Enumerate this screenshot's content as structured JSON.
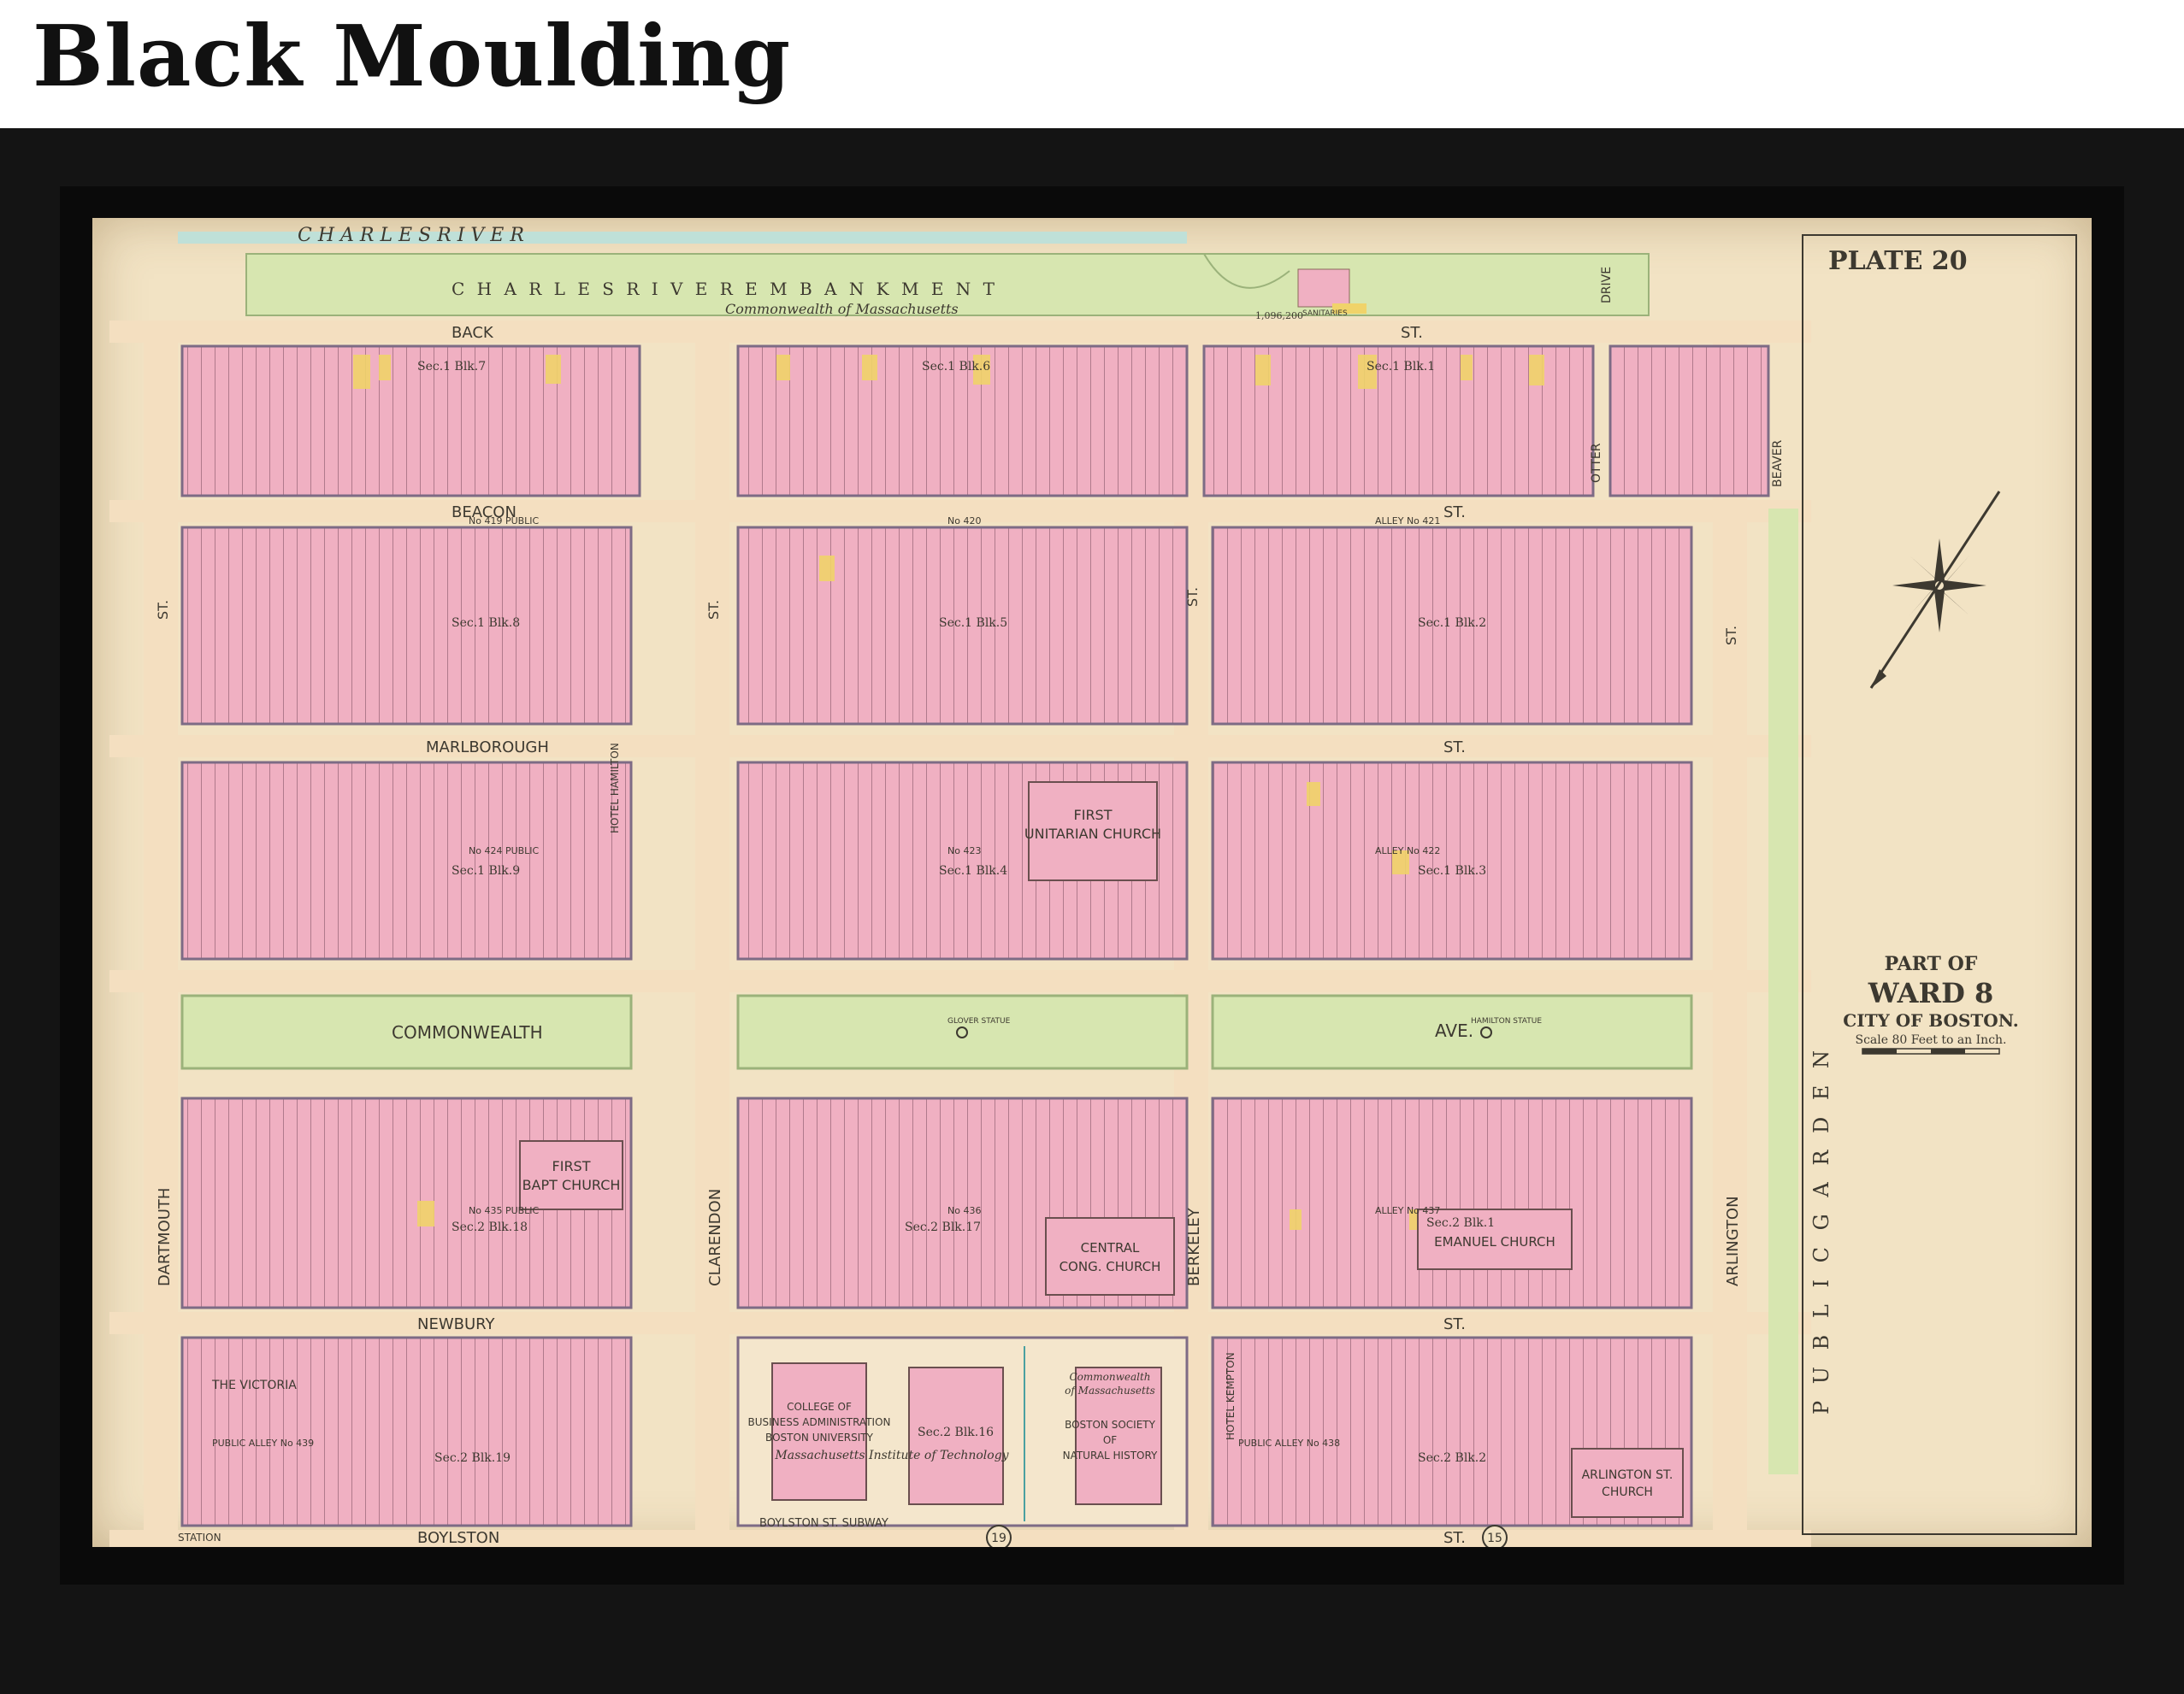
{
  "page": {
    "title": "Black Moulding"
  },
  "map": {
    "plate": "PLATE 20",
    "river": "C H A R L E S               R I V E R",
    "embankment": "C H A R L E S     R I V E R     E M B A N K M E N T",
    "embankment_owner": "Commonwealth   of   Massachusetts",
    "embankment_area": "1,096,200",
    "sanitaries": "SANITARIES",
    "streets": {
      "back": "BACK",
      "back_st": "ST.",
      "beacon": "BEACON",
      "beacon_st": "ST.",
      "marlborough": "MARLBOROUGH",
      "marlborough_st": "ST.",
      "commonwealth": "COMMONWEALTH",
      "commonwealth_ave": "AVE.",
      "newbury": "NEWBURY",
      "newbury_st": "ST.",
      "boylston": "BOYLSTON",
      "boylston_st": "ST.",
      "boylston_subway": "BOYLSTON   ST.   SUBWAY",
      "dartmouth": "DARTMOUTH",
      "clarendon": "CLARENDON",
      "berkeley": "BERKELEY",
      "arlington": "ARLINGTON",
      "st": "ST.",
      "otter": "OTTER",
      "beaver": "BEAVER",
      "drive": "DRIVE",
      "station": "STATION"
    },
    "public_garden": "P U B L I C     G A R D E N",
    "alleys": [
      {
        "id": "alley-419",
        "label": "No 419    PUBLIC"
      },
      {
        "id": "alley-420",
        "label": "No 420"
      },
      {
        "id": "alley-421",
        "label": "ALLEY   No 421"
      },
      {
        "id": "alley-424",
        "label": "No 424    PUBLIC"
      },
      {
        "id": "alley-423",
        "label": "No 423"
      },
      {
        "id": "alley-422",
        "label": "ALLEY   No 422"
      },
      {
        "id": "alley-435",
        "label": "No 435    PUBLIC"
      },
      {
        "id": "alley-436",
        "label": "No 436"
      },
      {
        "id": "alley-437",
        "label": "ALLEY   No 437"
      },
      {
        "id": "alley-439",
        "label": "PUBLIC     ALLEY     No 439"
      },
      {
        "id": "alley-438",
        "label": "PUBLIC   ALLEY   No 438"
      }
    ],
    "blocks": [
      {
        "id": "sec1-blk7",
        "label": "Sec.1 Blk.7"
      },
      {
        "id": "sec1-blk6",
        "label": "Sec.1 Blk.6"
      },
      {
        "id": "sec1-blk1",
        "label": "Sec.1 Blk.1"
      },
      {
        "id": "sec1-blk8",
        "label": "Sec.1 Blk.8"
      },
      {
        "id": "sec1-blk5",
        "label": "Sec.1 Blk.5"
      },
      {
        "id": "sec1-blk2",
        "label": "Sec.1 Blk.2"
      },
      {
        "id": "sec1-blk9",
        "label": "Sec.1 Blk.9"
      },
      {
        "id": "sec1-blk4",
        "label": "Sec.1 Blk.4"
      },
      {
        "id": "sec1-blk3",
        "label": "Sec.1 Blk.3"
      },
      {
        "id": "sec2-blk18",
        "label": "Sec.2 Blk.18"
      },
      {
        "id": "sec2-blk17",
        "label": "Sec.2 Blk.17"
      },
      {
        "id": "sec2-blk1",
        "label": "Sec.2 Blk.1"
      },
      {
        "id": "sec2-blk19",
        "label": "Sec.2 Blk.19"
      },
      {
        "id": "sec2-blk16",
        "label": "Sec.2 Blk.16"
      },
      {
        "id": "sec2-blk2",
        "label": "Sec.2 Blk.2"
      }
    ],
    "buildings": {
      "first_unitarian": [
        "FIRST",
        "UNITARIAN CHURCH"
      ],
      "first_baptist": [
        "FIRST",
        "BAPT CHURCH"
      ],
      "central_cong": [
        "CENTRAL",
        "CONG. CHURCH"
      ],
      "emmanuel": "EMANUEL CHURCH",
      "arlington_church": [
        "ARLINGTON ST.",
        "CHURCH"
      ],
      "college": [
        "COLLEGE OF",
        "BUSINESS ADMINISTRATION",
        "BOSTON UNIVERSITY",
        "Massachusetts Institute of Technology"
      ],
      "natural_history": [
        "Commonwealth",
        "of Massachusetts",
        "BOSTON SOCIETY",
        "OF",
        "NATURAL HISTORY"
      ],
      "the_victoria": "THE VICTORIA",
      "hotel_hamilton": "HOTEL HAMILTON",
      "hotel_kempton": "HOTEL KEMPTON"
    },
    "monuments": {
      "glover": "GLOVER STATUE",
      "hamilton": "HAMILTON STATUE"
    },
    "title_block": {
      "part_of": "PART OF",
      "ward": "WARD 8",
      "city": "CITY OF BOSTON.",
      "scale": "Scale 80 Feet to an Inch."
    },
    "circles": [
      "19",
      "15"
    ]
  },
  "colors": {
    "frame": "#141414",
    "paper": "#f2e3c4",
    "brick": "#f2b3c4",
    "wood": "#f0d36a",
    "park": "#d7e6b0",
    "water": "#bfe0d8",
    "street": "#f4dfc0",
    "ink": "#3d3930"
  }
}
